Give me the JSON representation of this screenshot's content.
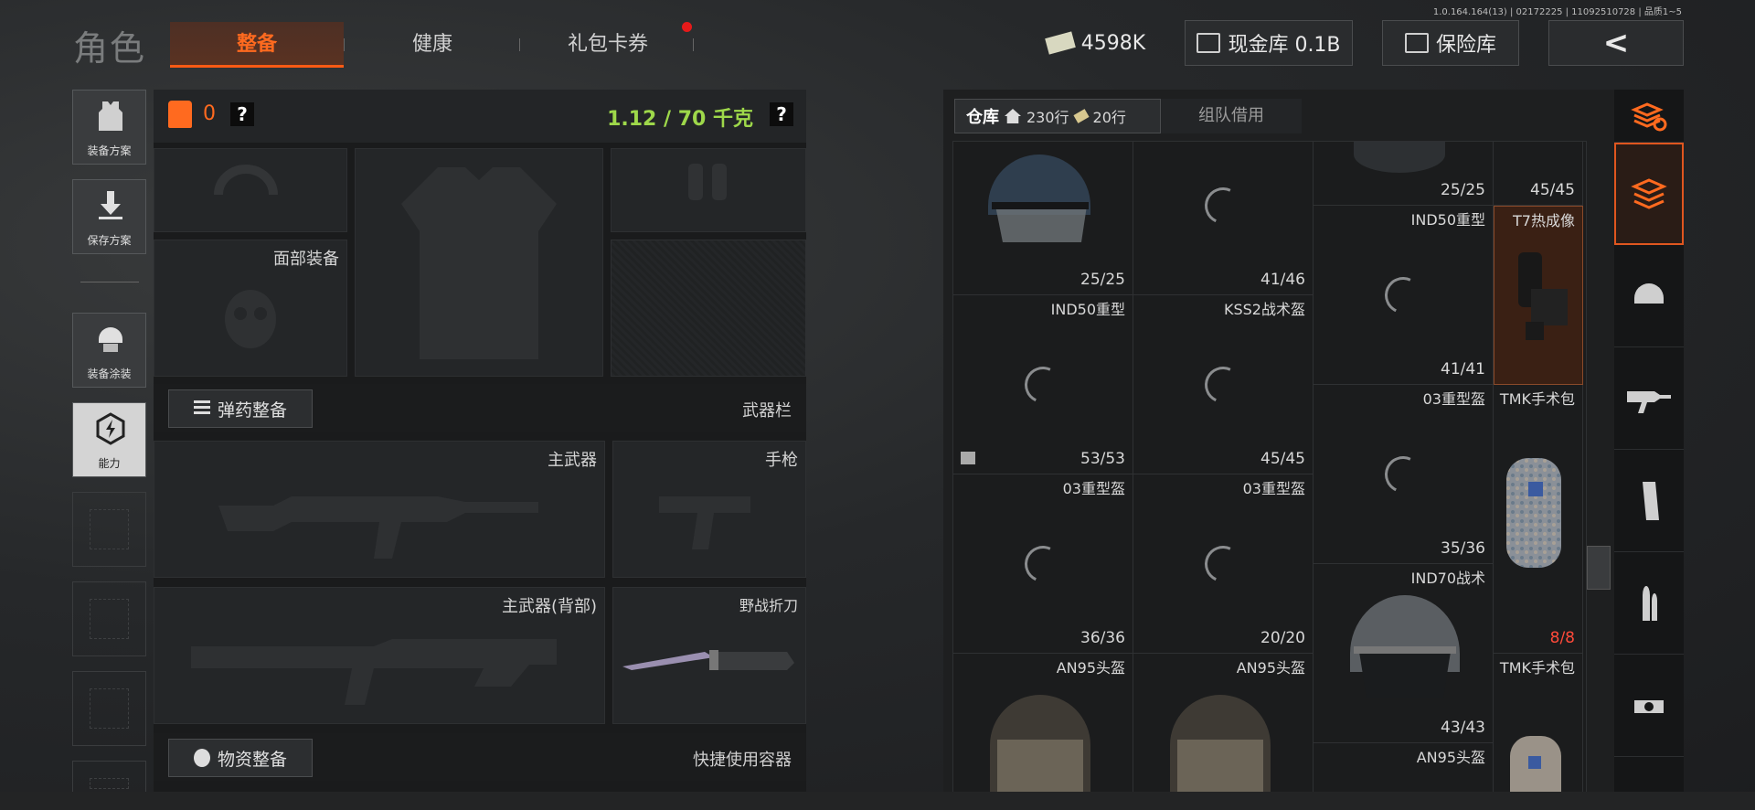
{
  "version": "1.0.164.164(13) | 02172225 | 11092510728 | 品质1~5",
  "title": "角色",
  "tabs": [
    {
      "label": "整备"
    },
    {
      "label": "健康"
    },
    {
      "label": "礼包卡券"
    }
  ],
  "currency": {
    "cash": "4598K",
    "bank": "现金库 0.1B",
    "vault": "保险库",
    "back": "<"
  },
  "side_menu": [
    {
      "label": "装备方案",
      "icon": "vest-icon"
    },
    {
      "label": "保存方案",
      "icon": "download-icon"
    },
    {
      "label": "装备涂装",
      "icon": "helmet-paint-icon"
    },
    {
      "label": "能力",
      "icon": "ability-icon"
    }
  ],
  "loadout": {
    "armor_count": "0",
    "help": "?",
    "weight": "1.12 / 70 千克",
    "face_gear": "面部装备",
    "ammo_button": "弹药整备",
    "weapon_bar": "武器栏",
    "primary": "主武器",
    "pistol": "手枪",
    "primary_back": "主武器(背部)",
    "knife": "野战折刀",
    "supply_button": "物资整备",
    "quick_container": "快捷使用容器"
  },
  "storage": {
    "tab_label": "仓库",
    "rows_a": "230行",
    "rows_b": "20行",
    "team_tab": "组队借用",
    "cells": [
      {
        "name": "",
        "count": "25/25"
      },
      {
        "name": "",
        "count": "41/46"
      },
      {
        "name": "IND50重型",
        "count": "25/25"
      },
      {
        "name": "T7热成像",
        "count": "45/45"
      },
      {
        "name": "IND50重型",
        "count": "53/53"
      },
      {
        "name": "KSS2战术盔",
        "count": "45/45"
      },
      {
        "name": "03重型盔",
        "count": "41/41"
      },
      {
        "name": "TMK手术包",
        "count": "8/8"
      },
      {
        "name": "03重型盔",
        "count": "36/36"
      },
      {
        "name": "03重型盔",
        "count": "20/20"
      },
      {
        "name": "IND70战术",
        "count": "35/36"
      },
      {
        "name": "AN95头盔",
        "count": "43/43"
      },
      {
        "name": "AN95头盔",
        "count": ""
      },
      {
        "name": "TMK手术包",
        "count": ""
      },
      {
        "name": "AN95头盔",
        "count": ""
      }
    ]
  },
  "right_bar": [
    {
      "icon": "stack-refresh-icon"
    },
    {
      "icon": "layers-icon"
    },
    {
      "icon": "helmet-icon"
    },
    {
      "icon": "rifle-icon"
    },
    {
      "icon": "magazine-icon"
    },
    {
      "icon": "ammo-icon"
    },
    {
      "icon": "scope-icon"
    }
  ]
}
